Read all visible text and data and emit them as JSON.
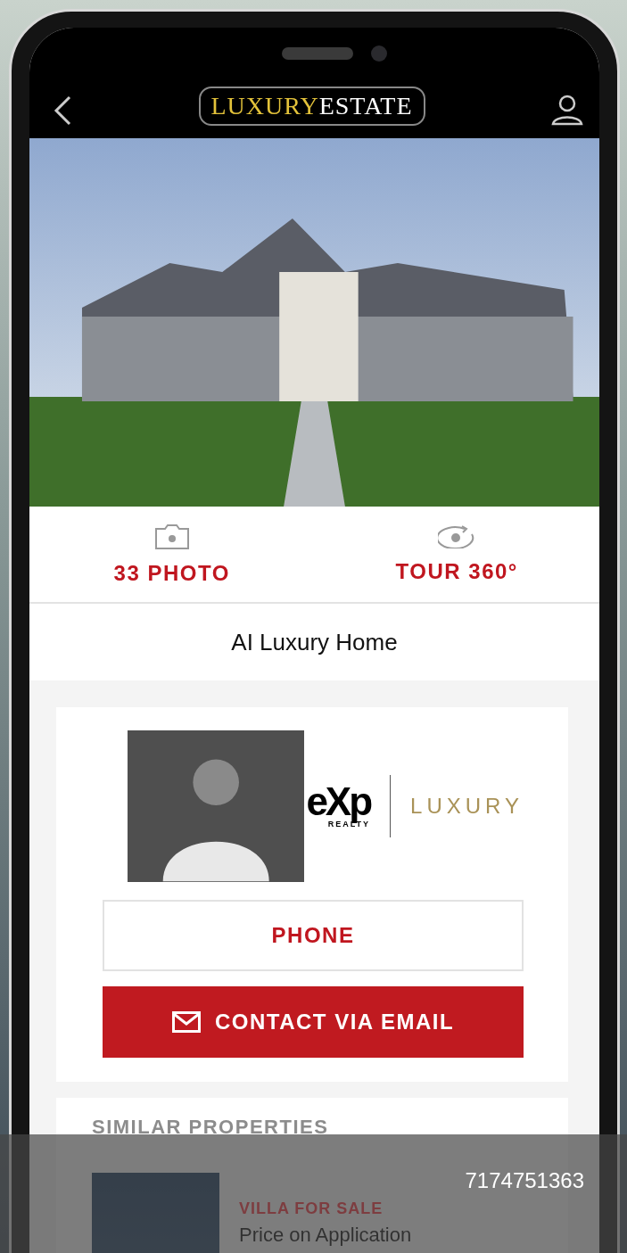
{
  "header": {
    "logo": {
      "part_1": "LUXURY",
      "part_2": "ESTATE"
    }
  },
  "media_tabs": [
    {
      "kind": "photo",
      "label": "33 PHOTO"
    },
    {
      "kind": "tour",
      "label": "TOUR 360°"
    }
  ],
  "listing_title": "AI Luxury Home",
  "agent": {
    "brokerage_logo": {
      "mark": "eXp",
      "sub": "REALTY",
      "tier": "LUXURY"
    },
    "buttons": [
      {
        "kind": "outline",
        "label": "PHONE"
      },
      {
        "kind": "filled",
        "label": "CONTACT VIA EMAIL"
      }
    ]
  },
  "similar_properties": {
    "heading": "SIMILAR PROPERTIES",
    "items": [
      {
        "type": "VILLA FOR SALE",
        "price": "Price on Application"
      }
    ]
  },
  "call_bar": {
    "phone": "7174751363"
  }
}
